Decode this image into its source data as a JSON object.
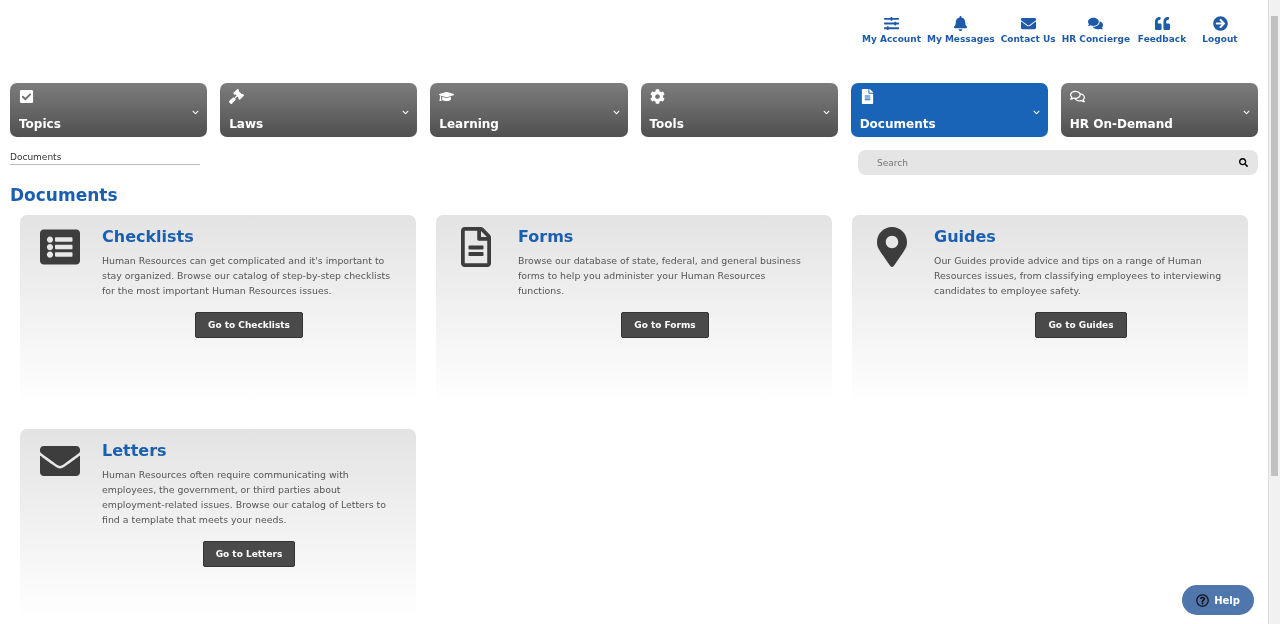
{
  "top_links": [
    {
      "kind": "sliders",
      "label": "My Account"
    },
    {
      "kind": "bell",
      "label": "My Messages"
    },
    {
      "kind": "envelope",
      "label": "Contact Us"
    },
    {
      "kind": "chat",
      "label": "HR Concierge"
    },
    {
      "kind": "quote",
      "label": "Feedback"
    },
    {
      "kind": "logout",
      "label": "Logout"
    }
  ],
  "nav_tabs": [
    {
      "kind": "check",
      "label": "Topics",
      "selected": false
    },
    {
      "kind": "gavel",
      "label": "Laws",
      "selected": false
    },
    {
      "kind": "cap",
      "label": "Learning",
      "selected": false
    },
    {
      "kind": "gear",
      "label": "Tools",
      "selected": false
    },
    {
      "kind": "file",
      "label": "Documents",
      "selected": true
    },
    {
      "kind": "chat",
      "label": "HR On-Demand",
      "selected": false
    }
  ],
  "breadcrumb": "Documents",
  "search": {
    "placeholder": "Search"
  },
  "page_title": "Documents",
  "cards": [
    {
      "kind": "list",
      "title": "Checklists",
      "text": "Human Resources can get complicated and it's important to stay organized. Browse our catalog of step-by-step checklists for the most important Human Resources issues.",
      "button": "Go to Checklists"
    },
    {
      "kind": "file",
      "title": "Forms",
      "text": "Browse our database of state, federal, and general business forms to help you administer your Human Resources functions.",
      "button": "Go to Forms"
    },
    {
      "kind": "pin",
      "title": "Guides",
      "text": "Our Guides provide advice and tips on a range of Human Resources issues, from classifying employees to interviewing candidates to employee safety.",
      "button": "Go to Guides"
    },
    {
      "kind": "envelope",
      "title": "Letters",
      "text": "Human Resources often require communicating with employees, the government, or third parties about employment-related issues. Browse our catalog of Letters to find a template that meets your needs.",
      "button": "Go to Letters"
    }
  ],
  "help_button": "Help"
}
